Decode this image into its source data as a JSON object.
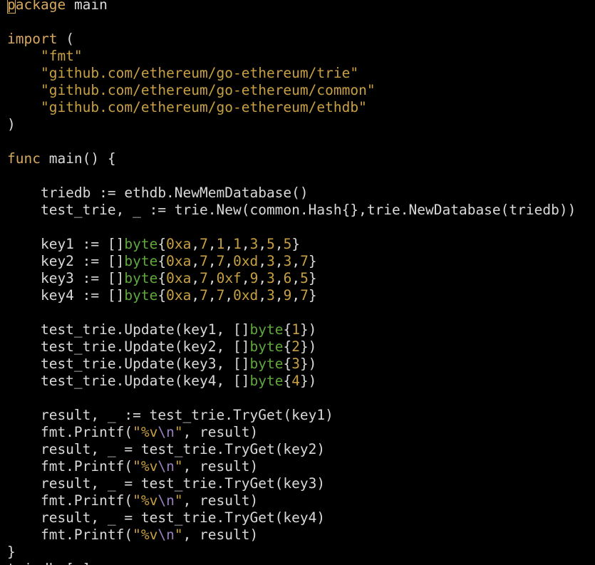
{
  "editor": {
    "theme": {
      "background": "#000000",
      "keyword": "#d7a85f",
      "string": "#c8a044",
      "type": "#5fa83a",
      "escape": "#9a7fc0",
      "text": "#d9d9d9"
    },
    "lines": [
      [
        {
          "c": "kw",
          "t": "package"
        },
        {
          "c": "plain",
          "t": " main"
        }
      ],
      [],
      [
        {
          "c": "kw",
          "t": "import"
        },
        {
          "c": "plain",
          "t": " ("
        }
      ],
      [
        {
          "c": "plain",
          "t": "    "
        },
        {
          "c": "str",
          "t": "\"fmt\""
        }
      ],
      [
        {
          "c": "plain",
          "t": "    "
        },
        {
          "c": "str",
          "t": "\"github.com/ethereum/go-ethereum/trie\""
        }
      ],
      [
        {
          "c": "plain",
          "t": "    "
        },
        {
          "c": "str",
          "t": "\"github.com/ethereum/go-ethereum/common\""
        }
      ],
      [
        {
          "c": "plain",
          "t": "    "
        },
        {
          "c": "str",
          "t": "\"github.com/ethereum/go-ethereum/ethdb\""
        }
      ],
      [
        {
          "c": "plain",
          "t": ")"
        }
      ],
      [],
      [
        {
          "c": "kw",
          "t": "func"
        },
        {
          "c": "plain",
          "t": " main() {"
        }
      ],
      [],
      [
        {
          "c": "plain",
          "t": "    triedb := ethdb.NewMemDatabase()"
        }
      ],
      [
        {
          "c": "plain",
          "t": "    test_trie, _ := trie.New(common.Hash{},trie.NewDatabase(triedb))"
        }
      ],
      [],
      [
        {
          "c": "plain",
          "t": "    key1 := []"
        },
        {
          "c": "type",
          "t": "byte"
        },
        {
          "c": "plain",
          "t": "{"
        },
        {
          "c": "num",
          "t": "0xa"
        },
        {
          "c": "plain",
          "t": ","
        },
        {
          "c": "num",
          "t": "7"
        },
        {
          "c": "plain",
          "t": ","
        },
        {
          "c": "num",
          "t": "1"
        },
        {
          "c": "plain",
          "t": ","
        },
        {
          "c": "num",
          "t": "1"
        },
        {
          "c": "plain",
          "t": ","
        },
        {
          "c": "num",
          "t": "3"
        },
        {
          "c": "plain",
          "t": ","
        },
        {
          "c": "num",
          "t": "5"
        },
        {
          "c": "plain",
          "t": ","
        },
        {
          "c": "num",
          "t": "5"
        },
        {
          "c": "plain",
          "t": "}"
        }
      ],
      [
        {
          "c": "plain",
          "t": "    key2 := []"
        },
        {
          "c": "type",
          "t": "byte"
        },
        {
          "c": "plain",
          "t": "{"
        },
        {
          "c": "num",
          "t": "0xa"
        },
        {
          "c": "plain",
          "t": ","
        },
        {
          "c": "num",
          "t": "7"
        },
        {
          "c": "plain",
          "t": ","
        },
        {
          "c": "num",
          "t": "7"
        },
        {
          "c": "plain",
          "t": ","
        },
        {
          "c": "num",
          "t": "0xd"
        },
        {
          "c": "plain",
          "t": ","
        },
        {
          "c": "num",
          "t": "3"
        },
        {
          "c": "plain",
          "t": ","
        },
        {
          "c": "num",
          "t": "3"
        },
        {
          "c": "plain",
          "t": ","
        },
        {
          "c": "num",
          "t": "7"
        },
        {
          "c": "plain",
          "t": "}"
        }
      ],
      [
        {
          "c": "plain",
          "t": "    key3 := []"
        },
        {
          "c": "type",
          "t": "byte"
        },
        {
          "c": "plain",
          "t": "{"
        },
        {
          "c": "num",
          "t": "0xa"
        },
        {
          "c": "plain",
          "t": ","
        },
        {
          "c": "num",
          "t": "7"
        },
        {
          "c": "plain",
          "t": ","
        },
        {
          "c": "num",
          "t": "0xf"
        },
        {
          "c": "plain",
          "t": ","
        },
        {
          "c": "num",
          "t": "9"
        },
        {
          "c": "plain",
          "t": ","
        },
        {
          "c": "num",
          "t": "3"
        },
        {
          "c": "plain",
          "t": ","
        },
        {
          "c": "num",
          "t": "6"
        },
        {
          "c": "plain",
          "t": ","
        },
        {
          "c": "num",
          "t": "5"
        },
        {
          "c": "plain",
          "t": "}"
        }
      ],
      [
        {
          "c": "plain",
          "t": "    key4 := []"
        },
        {
          "c": "type",
          "t": "byte"
        },
        {
          "c": "plain",
          "t": "{"
        },
        {
          "c": "num",
          "t": "0xa"
        },
        {
          "c": "plain",
          "t": ","
        },
        {
          "c": "num",
          "t": "7"
        },
        {
          "c": "plain",
          "t": ","
        },
        {
          "c": "num",
          "t": "7"
        },
        {
          "c": "plain",
          "t": ","
        },
        {
          "c": "num",
          "t": "0xd"
        },
        {
          "c": "plain",
          "t": ","
        },
        {
          "c": "num",
          "t": "3"
        },
        {
          "c": "plain",
          "t": ","
        },
        {
          "c": "num",
          "t": "9"
        },
        {
          "c": "plain",
          "t": ","
        },
        {
          "c": "num",
          "t": "7"
        },
        {
          "c": "plain",
          "t": "}"
        }
      ],
      [],
      [
        {
          "c": "plain",
          "t": "    test_trie.Update(key1, []"
        },
        {
          "c": "type",
          "t": "byte"
        },
        {
          "c": "plain",
          "t": "{"
        },
        {
          "c": "num",
          "t": "1"
        },
        {
          "c": "plain",
          "t": "})"
        }
      ],
      [
        {
          "c": "plain",
          "t": "    test_trie.Update(key2, []"
        },
        {
          "c": "type",
          "t": "byte"
        },
        {
          "c": "plain",
          "t": "{"
        },
        {
          "c": "num",
          "t": "2"
        },
        {
          "c": "plain",
          "t": "})"
        }
      ],
      [
        {
          "c": "plain",
          "t": "    test_trie.Update(key3, []"
        },
        {
          "c": "type",
          "t": "byte"
        },
        {
          "c": "plain",
          "t": "{"
        },
        {
          "c": "num",
          "t": "3"
        },
        {
          "c": "plain",
          "t": "})"
        }
      ],
      [
        {
          "c": "plain",
          "t": "    test_trie.Update(key4, []"
        },
        {
          "c": "type",
          "t": "byte"
        },
        {
          "c": "plain",
          "t": "{"
        },
        {
          "c": "num",
          "t": "4"
        },
        {
          "c": "plain",
          "t": "})"
        }
      ],
      [],
      [
        {
          "c": "plain",
          "t": "    result, _ := test_trie.TryGet(key1)"
        }
      ],
      [
        {
          "c": "plain",
          "t": "    fmt.Printf("
        },
        {
          "c": "str",
          "t": "\"%v"
        },
        {
          "c": "esc",
          "t": "\\n"
        },
        {
          "c": "str",
          "t": "\""
        },
        {
          "c": "plain",
          "t": ", result)"
        }
      ],
      [
        {
          "c": "plain",
          "t": "    result, _ = test_trie.TryGet(key2)"
        }
      ],
      [
        {
          "c": "plain",
          "t": "    fmt.Printf("
        },
        {
          "c": "str",
          "t": "\"%v"
        },
        {
          "c": "esc",
          "t": "\\n"
        },
        {
          "c": "str",
          "t": "\""
        },
        {
          "c": "plain",
          "t": ", result)"
        }
      ],
      [
        {
          "c": "plain",
          "t": "    result, _ = test_trie.TryGet(key3)"
        }
      ],
      [
        {
          "c": "plain",
          "t": "    fmt.Printf("
        },
        {
          "c": "str",
          "t": "\"%v"
        },
        {
          "c": "esc",
          "t": "\\n"
        },
        {
          "c": "str",
          "t": "\""
        },
        {
          "c": "plain",
          "t": ", result)"
        }
      ],
      [
        {
          "c": "plain",
          "t": "    result, _ = test_trie.TryGet(key4)"
        }
      ],
      [
        {
          "c": "plain",
          "t": "    fmt.Printf("
        },
        {
          "c": "str",
          "t": "\"%v"
        },
        {
          "c": "esc",
          "t": "\\n"
        },
        {
          "c": "str",
          "t": "\""
        },
        {
          "c": "plain",
          "t": ", result)"
        }
      ],
      [
        {
          "c": "plain",
          "t": "}"
        }
      ]
    ],
    "cursor": {
      "line": 1,
      "column": 1
    },
    "clipped_last_line": "triedb [:]"
  }
}
